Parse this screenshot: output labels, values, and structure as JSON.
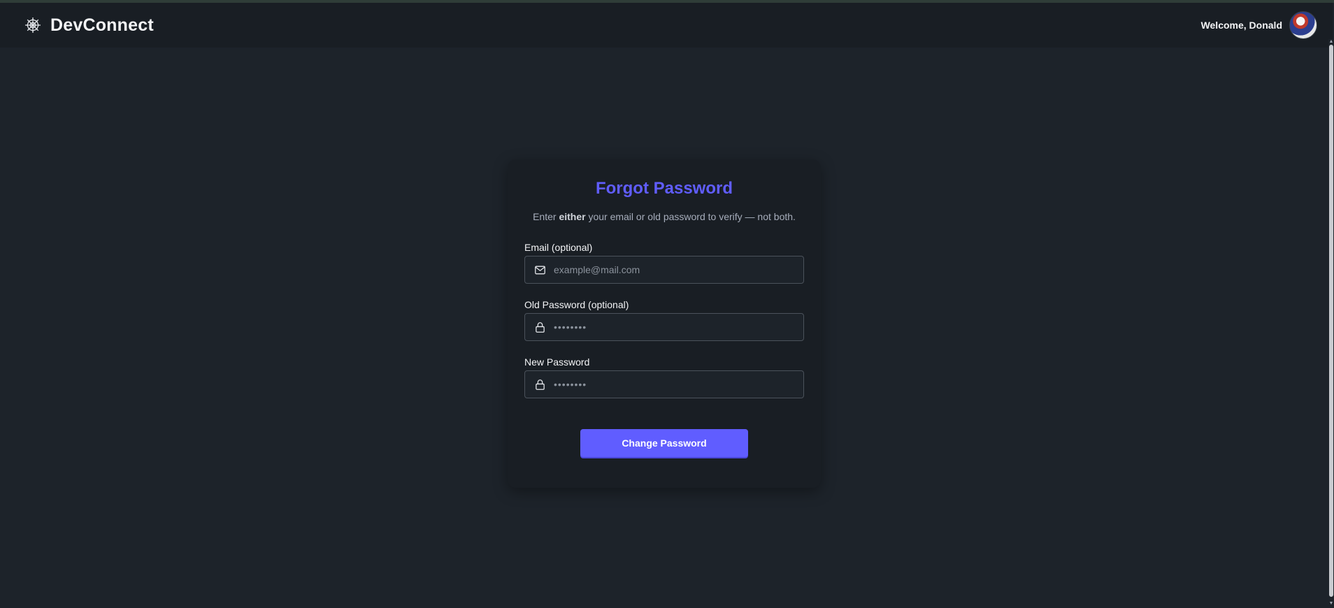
{
  "navbar": {
    "brand_name": "DevConnect",
    "brand_icon": "spiderweb-icon",
    "welcome_text": "Welcome, Donald",
    "avatar_icon": "user-avatar"
  },
  "form": {
    "title": "Forgot Password",
    "description_prefix": "Enter ",
    "description_emphasis": "either",
    "description_suffix": " your email or old password to verify — not both.",
    "email": {
      "label": "Email (optional)",
      "placeholder": "example@mail.com",
      "value": "",
      "icon": "mail-icon"
    },
    "old_password": {
      "label": "Old Password (optional)",
      "placeholder": "••••••••",
      "value": "",
      "icon": "lock-icon"
    },
    "new_password": {
      "label": "New Password",
      "placeholder": "••••••••",
      "value": "",
      "icon": "lock-icon"
    },
    "submit_label": "Change Password"
  },
  "colors": {
    "accent": "#605dff",
    "background": "#1d232a",
    "navbar": "#191e24",
    "card": "#191e24"
  }
}
